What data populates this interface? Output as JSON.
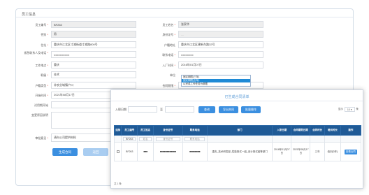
{
  "section": {
    "title": "员工信息"
  },
  "form": {
    "employee_no": {
      "label": "员工编号",
      "value": "BF263"
    },
    "employee_name": {
      "label": "员工姓名",
      "value": "张家华"
    },
    "gender": {
      "label": "性别",
      "value": "男"
    },
    "id_card": {
      "label": "身份证号",
      "value": "—"
    },
    "address": {
      "label": "住址",
      "value": "重庆市江北区寸滩街道寸滩路800号"
    },
    "hukou_address": {
      "label": "户籍地址",
      "value": "重庆市江北区建新东路32号"
    },
    "emergency_contact": {
      "label": "紧急联系人及电话",
      "value": "■■■■■■■■■■"
    },
    "contact_phone": {
      "label": "联系电话",
      "value": "■■■■■■■■"
    },
    "work_place": {
      "label": "工作地点",
      "value": "重庆"
    },
    "entry_date": {
      "label": "入厂时间",
      "value": "2016年01月07日"
    },
    "title": {
      "label": "职级",
      "value": "技术"
    },
    "unit": {
      "label": "单位",
      "value": ""
    },
    "hukou_type": {
      "label": "户籍类型",
      "value": "非农业城镇户口"
    },
    "contract_period": {
      "label": "合同期限",
      "value": ""
    },
    "start_date": {
      "label": "开始时间",
      "value": "2021年08月17日"
    },
    "end_date": {
      "label": "结束时间",
      "value": ""
    },
    "probation_start": {
      "label": "试用期开始",
      "value": ""
    },
    "probation_end": {
      "label": "试用期结束",
      "value": ""
    },
    "change_reason": {
      "label": "变更原因说明",
      "value": ""
    },
    "approval": {
      "label": "审批意见",
      "value": "请向公司提供材料"
    },
    "generate_button": "生成合同",
    "return_button": "返回"
  },
  "contract_dropdown": {
    "options": [
      "固定期限(三年)",
      "固定期限(五年)",
      "以完成工作任务为期限"
    ],
    "selected_index": 1
  },
  "modal": {
    "title": "已生成合同清单",
    "date_label": "入职日期",
    "to_label": "至",
    "query_button": "查询",
    "export_button": "导出合同",
    "batch_button": "批量操作",
    "page_size_label": "显示",
    "page_size": "10",
    "page_size_unit": "条",
    "columns": [
      "选择",
      "员工编号",
      "员工姓名",
      "身份证号",
      "联系电话",
      "部门",
      "入职日期",
      "合同期限日期",
      "合同时长",
      "培训时长",
      "操作"
    ],
    "filter_row": {
      "employee_no": "BF263",
      "name_placeholder": "姓名",
      "id_placeholder": "身份证号",
      "phone_placeholder": "联系电话"
    },
    "rows": [
      {
        "employee_no": "BF263",
        "name": "■■■",
        "id_card": "■■■■■■■■■■■■",
        "phone": "■■■■■■■■",
        "department": "重庆_技术研发部_性能测试一组_设计测试组等部门",
        "entry_date": "2016年01月07日",
        "contract_date": "2021年08月17日",
        "duration": "三年",
        "training": "培训(3年)",
        "action": "查看合同"
      }
    ],
    "footer": "共 1 条"
  }
}
